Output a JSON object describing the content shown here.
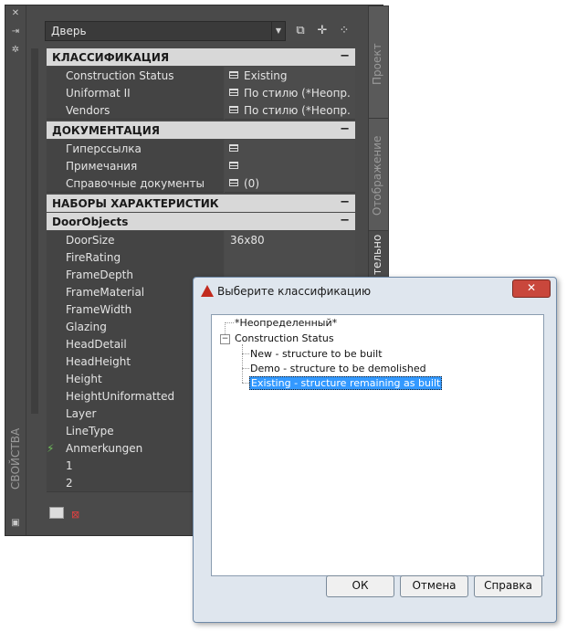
{
  "palette": {
    "type_combo": "Дверь",
    "vertical_title": "СВОЙСТВА",
    "tabs": [
      "Проект",
      "Отображение",
      "тельно"
    ],
    "sections": {
      "classification": {
        "title": "КЛАССИФИКАЦИЯ",
        "rows": [
          {
            "key": "Construction Status",
            "value": "Existing"
          },
          {
            "key": "Uniformat II",
            "value": "По стилю (*Неопр..."
          },
          {
            "key": "Vendors",
            "value": "По стилю (*Неопр..."
          }
        ]
      },
      "documentation": {
        "title": "ДОКУМЕНТАЦИЯ",
        "rows": [
          {
            "key": "Гиперссылка",
            "value": ""
          },
          {
            "key": "Примечания",
            "value": ""
          },
          {
            "key": "Справочные документы",
            "value": "(0)"
          }
        ]
      },
      "property_sets": {
        "title": "НАБОРЫ ХАРАКТЕРИСТИК"
      },
      "door_objects": {
        "title": "DoorObjects",
        "rows": [
          {
            "key": "DoorSize",
            "value": "36x80"
          },
          {
            "key": "FireRating",
            "value": ""
          },
          {
            "key": "FrameDepth",
            "value": ""
          },
          {
            "key": "FrameMaterial",
            "value": ""
          },
          {
            "key": "FrameWidth",
            "value": ""
          },
          {
            "key": "Glazing",
            "value": ""
          },
          {
            "key": "HeadDetail",
            "value": ""
          },
          {
            "key": "HeadHeight",
            "value": ""
          },
          {
            "key": "Height",
            "value": ""
          },
          {
            "key": "HeightUniformatted",
            "value": ""
          },
          {
            "key": "Layer",
            "value": ""
          },
          {
            "key": "LineType",
            "value": ""
          },
          {
            "key": "Anmerkungen",
            "value": ""
          },
          {
            "key": "1",
            "value": ""
          },
          {
            "key": "2",
            "value": ""
          }
        ]
      }
    },
    "collapse_symbol": "−"
  },
  "dialog": {
    "title": "Выберите классификацию",
    "close": "✕",
    "tree": {
      "undefined": "*Неопределенный*",
      "root": "Construction Status",
      "children": [
        "New - structure to be built",
        "Demo - structure to be demolished",
        "Existing - structure remaining as built"
      ],
      "expander": "−"
    },
    "buttons": {
      "ok": "ОК",
      "cancel": "Отмена",
      "help": "Справка"
    }
  }
}
